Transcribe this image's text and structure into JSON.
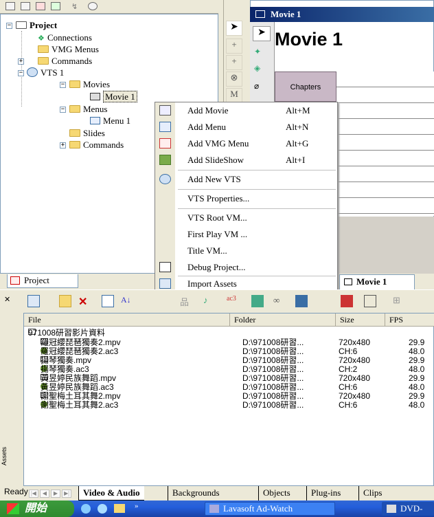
{
  "project_tree": {
    "root": "Project",
    "items": [
      "Connections",
      "VMG Menus",
      "Commands",
      "VTS 1",
      "Movies",
      "Movie 1",
      "Menus",
      "Menu 1",
      "Slides",
      "Commands"
    ]
  },
  "project_tab": "Project",
  "editor": {
    "window_title": "Movie 1",
    "big_title": "Movie 1",
    "chapters_label": "Chapters",
    "tab_label": "Movie 1"
  },
  "context_menu": {
    "items": [
      {
        "label": "Add Movie",
        "shortcut": "Alt+M"
      },
      {
        "label": "Add Menu",
        "shortcut": "Alt+N"
      },
      {
        "label": "Add VMG Menu",
        "shortcut": "Alt+G"
      },
      {
        "label": "Add SlideShow",
        "shortcut": "Alt+I"
      },
      {
        "label": "Add New VTS",
        "shortcut": ""
      },
      {
        "label": "VTS Properties...",
        "shortcut": ""
      },
      {
        "label": "VTS Root VM...",
        "shortcut": ""
      },
      {
        "label": "First Play VM ...",
        "shortcut": ""
      },
      {
        "label": "Title VM...",
        "shortcut": ""
      },
      {
        "label": "Debug Project...",
        "shortcut": ""
      },
      {
        "label": "Import Assets",
        "shortcut": ""
      }
    ]
  },
  "assets": {
    "columns": [
      "File",
      "Folder",
      "Size",
      "FPS"
    ],
    "group_folder": "971008研習影片資料",
    "rows": [
      {
        "type": "video",
        "file": "羅冠纓琵琶獨奏2.mpv",
        "folder": "D:\\971008研習...",
        "size": "720x480",
        "fps": "29.9"
      },
      {
        "type": "audio",
        "file": "羅冠纓琵琶獨奏2.ac3",
        "folder": "D:\\971008研習...",
        "size": "CH:6",
        "fps": "48.0"
      },
      {
        "type": "video",
        "file": "揚琴獨奏.mpv",
        "folder": "D:\\971008研習...",
        "size": "720x480",
        "fps": "29.9"
      },
      {
        "type": "audio",
        "file": "揚琴獨奏.ac3",
        "folder": "D:\\971008研習...",
        "size": "CH:2",
        "fps": "48.0"
      },
      {
        "type": "video",
        "file": "黃昱婷民族舞蹈.mpv",
        "folder": "D:\\971008研習...",
        "size": "720x480",
        "fps": "29.9"
      },
      {
        "type": "audio",
        "file": "黃昱婷民族舞蹈.ac3",
        "folder": "D:\\971008研習...",
        "size": "CH:6",
        "fps": "48.0"
      },
      {
        "type": "video",
        "file": "謝聖梅土耳其舞2.mpv",
        "folder": "D:\\971008研習...",
        "size": "720x480",
        "fps": "29.9"
      },
      {
        "type": "audio",
        "file": "謝聖梅土耳其舞2.ac3",
        "folder": "D:\\971008研習...",
        "size": "CH:6",
        "fps": "48.0"
      }
    ],
    "side_label": "Assets",
    "tabs": [
      "Video & Audio",
      "Backgrounds",
      "Objects",
      "Plug-ins",
      "Clips"
    ]
  },
  "status": "Ready",
  "taskbar": {
    "start": "開始",
    "tasks": [
      "Lavasoft Ad-Watch",
      "DVD-"
    ]
  }
}
